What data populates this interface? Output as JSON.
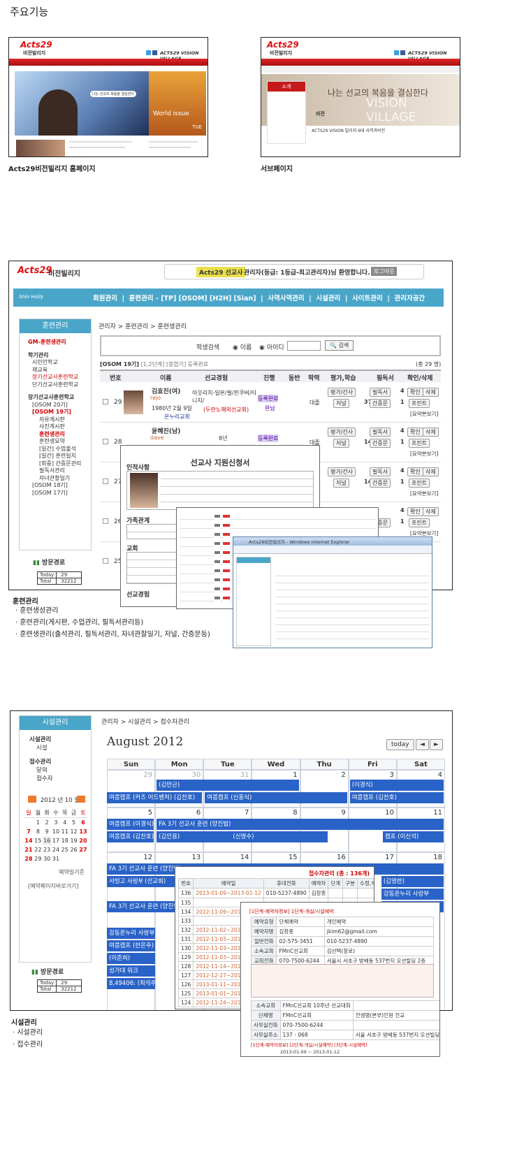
{
  "section_title": "주요기능",
  "shot1": {
    "caption": "Acts29비전빌리지 홈페이지",
    "logo": "Acts29",
    "logo_sub": "비전빌리지",
    "vision": "ACTS29 VISION VILLAGE",
    "banner_text": "나는 선교의 복음을 결심한다",
    "worlds": "World issue",
    "tue": "TUE"
  },
  "shot2": {
    "caption": "서브페이지",
    "logo": "Acts29",
    "logo_sub": "비전빌리지",
    "vision": "ACTS29 VISION VILLAGE",
    "intro": "소개",
    "headline": "나는 선교의 복음을 결심한다",
    "vision_big": "VISION VILLAGE",
    "vision_label": "비전",
    "vision_desc": "ACTS29 VISION 빌리지 6대 사역과비전"
  },
  "shot3": {
    "logo": "Acts29",
    "logo_sub": "비전빌리지",
    "badge": "Acts29 선교사",
    "welcome": "관리자(등급: 1등급-최고관리자)님 환영합니다.",
    "logout": "로그아웃",
    "brand": "Shin Holly",
    "nav": [
      "회원관리",
      "훈련관리 - [TP] [OSOM] [H2H] [Sian]",
      "사역사역관리",
      "시설관리",
      "사이트관리",
      "관리자공간"
    ],
    "side_title": "훈련관리",
    "side_items": [
      "GM-훈련생관리",
      "학기관리",
      "시민안학교",
      "재교육",
      "장기선교사훈련학교",
      "단기선교사훈련학교",
      "장기선교사훈련학교",
      "[OSOM 20기]",
      "[OSOM 19기]",
      "자유게시판",
      "사진게시판",
      "훈련생관리",
      "훈련생요약",
      "[일간] 수업출석",
      "[일간] 훈련일지",
      "[회중] 간증문관리",
      "필독서관리",
      "자녀관찰일기",
      "[OSOM 18기]",
      "[OSOM 17기]"
    ],
    "visit_label": "방문경로",
    "today_label": "Today",
    "today_val": "29",
    "total_label": "Total",
    "total_val": "32212",
    "breadcrumb": "관리자 > 훈련관리 > 훈련생관리",
    "search_label": "학생검색",
    "radio_name": "이름",
    "radio_id": "아이디",
    "search_btn": "검색",
    "list_title": "[OSOM 19기]",
    "list_sub": "[1,2단계] [봉합기] 등록완료",
    "count": "(총 29 명)",
    "headers": [
      "번호",
      "이름",
      "선교경험",
      "진행",
      "동반",
      "학력",
      "평가,학습",
      "필독서",
      "확인/삭제"
    ],
    "rows": [
      {
        "no": "29",
        "name": "김효진(여)",
        "id": "rejo",
        "birth": "1980년 2월 9일",
        "church": "온누리교회",
        "exp": "아웃리치-일본/필/핀쿠버/티니지/",
        "exp2": "(두란노해외선교회)",
        "status": "등록완료",
        "status2": "완납",
        "edu": "대졸",
        "n1": "4",
        "n2": "37",
        "n3": "1"
      },
      {
        "no": "28",
        "name": "윤혜진(남)",
        "id": "dave",
        "exp": "8년",
        "status": "등록완료",
        "edu": "대졸",
        "n1": "4",
        "n2": "14",
        "n3": "1"
      },
      {
        "no": "27",
        "n1": "4",
        "n2": "14",
        "n3": "1"
      },
      {
        "no": "26",
        "n1": "4",
        "n3": "1"
      },
      {
        "no": "25"
      }
    ],
    "btn_eval": "평가/간사",
    "btn_journal": "저널",
    "btn_reading": "필독서",
    "btn_testimony": "간증문",
    "btn_confirm": "확인",
    "btn_delete": "삭제",
    "btn_print": "프린트",
    "btn_summary": "[요약본보기]",
    "form_title": "선교사 지원신청서",
    "form_section1": "인적사항",
    "form_section2": "가족관계",
    "form_section3": "교회",
    "form_section4": "선교경험",
    "caption": "훈련관리",
    "bullets": [
      "훈련생성관리",
      "훈련관리(게시판, 수업관리, 필독서관리등)",
      "훈련생관리(출석관리, 필독서관리, 자녀관찰일기, 저널, 간증문등)"
    ],
    "ie_title": "Acts29비전빌리지 - Windows Internet Explorer"
  },
  "shot4": {
    "side_title": "시설관리",
    "side_items": [
      "시설관리",
      "시설",
      "접수관리",
      "달력",
      "접수자"
    ],
    "mini_cal_title": "2012 년 10 월",
    "dow": [
      "일",
      "월",
      "화",
      "수",
      "목",
      "금",
      "토"
    ],
    "mini_weeks": [
      [
        "",
        "1",
        "2",
        "3",
        "4",
        "5",
        "6"
      ],
      [
        "7",
        "8",
        "9",
        "10",
        "11",
        "12",
        "13"
      ],
      [
        "14",
        "15",
        "16",
        "17",
        "18",
        "19",
        "20"
      ],
      [
        "21",
        "22",
        "23",
        "24",
        "25",
        "26",
        "27"
      ],
      [
        "28",
        "29",
        "30",
        "31",
        "",
        "",
        ""
      ]
    ],
    "legend": "예약일기준",
    "quick": "[예약페이지바로가기]",
    "visit_label": "방문경로",
    "today_label": "Today",
    "today_val": "29",
    "total_label": "Total",
    "total_val": "32212",
    "breadcrumb": "관리자 > 시설관리 > 접수자관리",
    "month": "August 2012",
    "today_btn": "today",
    "prev": "◄",
    "next": "►",
    "days": [
      "Sun",
      "Mon",
      "Tue",
      "Wed",
      "Thu",
      "Fri",
      "Sat"
    ],
    "weeks": [
      [
        "29",
        "30",
        "31",
        "1",
        "2",
        "3",
        "4"
      ],
      [
        "5",
        "6",
        "7",
        "8",
        "9",
        "10",
        "11"
      ],
      [
        "12",
        "13",
        "14",
        "15",
        "16",
        "17",
        "18"
      ]
    ],
    "events": [
      "(김만곤)",
      "(이경식)",
      "여름캠프 (커즈 어드벤처) (김찬호)",
      "여름캠프 (신홍식)",
      "여름캠프 (김찬호)",
      "여름캠프 (이경식)",
      "FA 3기 선교사 훈련 (양진법)",
      "여름캠프 (김찬호)",
      "(김인용)",
      "(신영수)",
      "캠프 (이신석)",
      "FA 3기 선교사 훈련 (양진법)",
      "서빙고 사랑부 여름캠프 (이신석)",
      "(선교회)",
      "(김영한)",
      "강동온누리 사랑부",
      "여름캠프 (한은주)",
      "FA 3기 선교사 훈련 (양진법)",
      "강동온누리 사랑부",
      "여름캠프 (한은주)",
      "(이준희)",
      "성가대 워크",
      "8,49406: (최석주)"
    ],
    "list_title": "접수자관리 (총 : 136개)",
    "list_headers": [
      "번호",
      "예약일",
      "휴대전화",
      "예약자",
      "단계",
      "구분",
      "수정,삭제"
    ],
    "list_rows": [
      [
        "136",
        "2013-01-09~2013-01-12",
        "010-5237-4890",
        "김창종"
      ],
      [
        "135",
        "",
        ""
      ],
      [
        "134",
        "2012-11-09~2012-11-04"
      ],
      [
        "133",
        ""
      ],
      [
        "132",
        "2012-11-02~2012-11-03"
      ],
      [
        "131",
        "2012-11-03~2012-11-04"
      ],
      [
        "130",
        "2012-11-03~2012-11-04"
      ],
      [
        "129",
        "2012-11-03~2012-11-04"
      ],
      [
        "128",
        "2012-11-14~2013-01-10"
      ],
      [
        "127",
        "2012-12-27~2012-12-29"
      ],
      [
        "126",
        "2013-01-11~2013-01-13"
      ],
      [
        "125",
        "2013-01-01~2013-01-06"
      ],
      [
        "124",
        "2012-11-24~2012-11-25"
      ]
    ],
    "detail_title": "[1단계-예약자정보] 1단계-개실/시설예약",
    "detail_rows": [
      [
        "예약유형",
        "단체예약",
        "개인예약"
      ],
      [
        "예약자명",
        "김창종",
        "jkim62@gmail.com"
      ],
      [
        "일반전화",
        "02-575-3451",
        "010-5237-4890"
      ],
      [
        "소속교회",
        "FMnC선교회",
        "김선택(장로)"
      ],
      [
        "교회전화",
        "070-7500-6244",
        "서울시 서초구 방배동 537번지 오션빌딩 2층"
      ]
    ],
    "detail_rows2": [
      [
        "소속교회",
        "FMnC선교회 10주년 선교대회"
      ],
      [
        "단체명",
        "FMnC선교회",
        "전생명(본부)인원 전교"
      ],
      [
        "사무실전화",
        "070-7500-6244"
      ],
      [
        "사무실주소",
        "137 - 068",
        "서울 서초구 방배동 537번지 오션빌딩 2층"
      ]
    ],
    "detail_footer": "[1단계-예약자정보] [2단계-개실/시설예약] [3단계-시설예약]",
    "detail_period": "2013-01-09 ~ 2013-01-12",
    "caption": "시설관리",
    "bullets": [
      "시설관리",
      "접수관리"
    ]
  }
}
